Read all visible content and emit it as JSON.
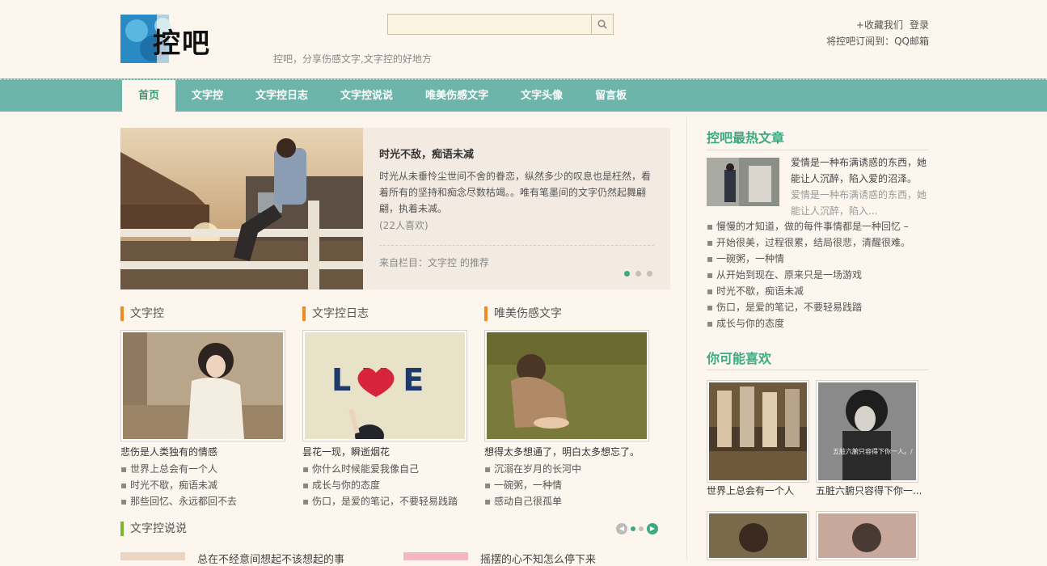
{
  "header": {
    "logo_text": "控吧",
    "tagline": "控吧，分享伤感文字,文字控的好地方",
    "search": {
      "placeholder": "",
      "value": ""
    },
    "links": {
      "favorite": "+收藏我们",
      "login": "登录",
      "subscribe": "将控吧订阅到：QQ邮箱"
    }
  },
  "nav": [
    "首页",
    "文字控",
    "文字控日志",
    "文字控说说",
    "唯美伤感文字",
    "文字头像",
    "留言板"
  ],
  "featured": {
    "title": "时光不敌，痴语未减",
    "text": "时光从未垂怜尘世间不舍的眷恋，纵然多少的叹息也是枉然，看着所有的坚持和痴念尽数枯竭。。唯有笔墨间的文字仍然起舞翩翩，执着未减。",
    "likes": "(22人喜欢)",
    "from": "来自栏目：文字控 的推荐"
  },
  "sections": [
    {
      "title": "文字控",
      "caption": "悲伤是人类独有的情感",
      "items": [
        "世界上总会有一个人",
        "时光不歇，痴语未减",
        "那些回忆、永远都回不去"
      ]
    },
    {
      "title": "文字控日志",
      "caption": "昙花一现，瞬逝烟花",
      "items": [
        "你什么时候能爱我像自己",
        "成长与你的态度",
        "伤口，是爱的笔记，不要轻易践踏"
      ]
    },
    {
      "title": "唯美伤感文字",
      "caption": "想得太多想通了，明白太多想忘了。",
      "items": [
        "沉溺在岁月的长河中",
        "一碗粥，一种情",
        "感动自己很孤单"
      ]
    }
  ],
  "bottom_section": {
    "title": "文字控说说",
    "items": [
      "总在不经意间想起不该想起的事",
      "摇摆的心不知怎么停下来"
    ]
  },
  "sidebar": {
    "hot_title": "控吧最热文章",
    "hot_feature": {
      "title": "爱情是一种布满诱惑的东西，她能让人沉醉，陷入爱的沼泽。",
      "excerpt": "爱情是一种布满诱惑的东西，她能让人沉醉，陷入..."
    },
    "hot_list": [
      "慢慢的才知道，做的每件事情都是一种回忆 –",
      "开始很美，过程很累，结局很悲，清醒很难。",
      "一碗粥，一种情",
      "从开始到现在、原来只是一场游戏",
      "时光不歇，痴语未减",
      "伤口，是爱的笔记，不要轻易践踏",
      "成长与你的态度"
    ],
    "like_title": "你可能喜欢",
    "like_items": [
      {
        "caption": "世界上总会有一个人",
        "overlay": ""
      },
      {
        "caption": "五脏六腑只容得下你一...",
        "overlay": "五脏六腑只容得下你一人。/"
      }
    ],
    "love_sign": "LVE"
  }
}
